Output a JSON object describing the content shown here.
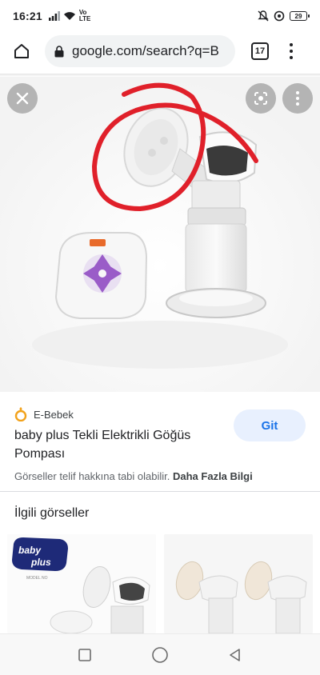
{
  "status_bar": {
    "time": "16:21",
    "volte_top": "Vo",
    "volte_bottom": "LTE",
    "battery": "29"
  },
  "browser": {
    "url": "google.com/search?q=B",
    "tab_count": "17"
  },
  "result": {
    "source": "E-Bebek",
    "title": "baby plus Tekli Elektrikli Göğüs Pompası",
    "go_button": "Git",
    "copyright_text": "Görseller telif hakkına tabi olabilir.",
    "more_info_link": "Daha Fazla Bilgi"
  },
  "related": {
    "title": "İlgili görseller",
    "thumb1_logo_top": "baby",
    "thumb1_logo_bottom": "plus",
    "thumb1_model": "MODEL NO"
  },
  "colors": {
    "accent": "#1a73e8",
    "annotation_red": "#e0202a",
    "product_purple": "#9a5cc8"
  }
}
